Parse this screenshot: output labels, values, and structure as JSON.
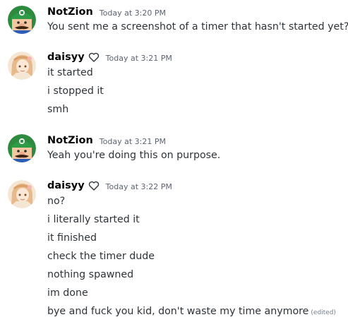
{
  "messages": [
    {
      "author": "NotZion",
      "timestamp": "Today at 3:20 PM",
      "lines": [
        "You sent me a screenshot of a timer that hasn't started yet?"
      ]
    },
    {
      "author": "daisyy",
      "timestamp": "Today at 3:21 PM",
      "lines": [
        "it started",
        "i stopped it",
        "smh"
      ]
    },
    {
      "author": "NotZion",
      "timestamp": "Today at 3:21 PM",
      "lines": [
        "Yeah you're doing this on purpose."
      ]
    },
    {
      "author": "daisyy",
      "timestamp": "Today at 3:22 PM",
      "lines": [
        "no?",
        "i literally started it",
        "it finished",
        "check the timer dude",
        "nothing spawned",
        "im done",
        "bye and fuck you kid, don't waste my time anymore"
      ],
      "edited_label": "(edited)"
    }
  ],
  "icons": {
    "notzion_avatar": "mario-style-avatar-icon",
    "daisyy_avatar": "anime-portrait-avatar-icon",
    "daisyy_badge": "heart-outline-icon"
  },
  "colors": {
    "background": "#ffffff",
    "username": "#060607",
    "text": "#2e3338",
    "timestamp": "#5c6370"
  }
}
